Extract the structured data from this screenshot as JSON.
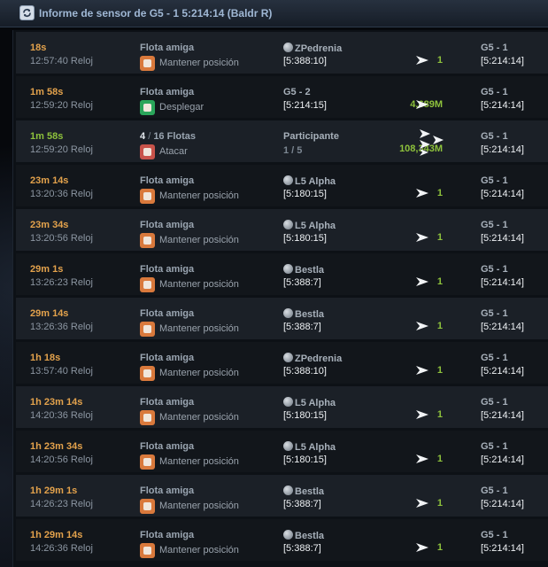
{
  "window": {
    "title": "Informe de sensor de G5 - 1 5:214:14 (Baldr R)",
    "icon": "refresh-icon"
  },
  "rows": [
    {
      "time": "18s",
      "clock": "12:57:40 Reloj",
      "mission_title": "Flota amiga",
      "action": "Mantener posición",
      "icon": "hold-position-icon",
      "origin_name": "ZPedrenia",
      "origin_coord": "[5:388:10]",
      "ships": "1",
      "dest_name": "G5 - 1",
      "dest_coord": "[5:214:14]"
    },
    {
      "time": "1m 58s",
      "clock": "12:59:20 Reloj",
      "mission_title": "Flota amiga",
      "action": "Desplegar",
      "icon": "deploy-icon",
      "origin_name": "G5 - 2",
      "origin_coord": "[5:214:15]",
      "ships": "4,689M",
      "dest_name": "G5 - 1",
      "dest_coord": "[5:214:14]"
    },
    {
      "time": "1m 58s",
      "clock": "12:59:20 Reloj",
      "fleet_count": "4",
      "fleet_total": "16",
      "fleet_word": "Flotas",
      "action": "Atacar",
      "icon": "attack-icon",
      "participant_label": "Participante",
      "participant_count": "1",
      "participant_total": "5",
      "ships": "108,343M",
      "dest_name": "G5 - 1",
      "dest_coord": "[5:214:14]"
    },
    {
      "time": "23m 14s",
      "clock": "13:20:36 Reloj",
      "mission_title": "Flota amiga",
      "action": "Mantener posición",
      "icon": "hold-position-icon",
      "origin_name": "L5 Alpha",
      "origin_coord": "[5:180:15]",
      "ships": "1",
      "dest_name": "G5 - 1",
      "dest_coord": "[5:214:14]"
    },
    {
      "time": "23m 34s",
      "clock": "13:20:56 Reloj",
      "mission_title": "Flota amiga",
      "action": "Mantener posición",
      "icon": "hold-position-icon",
      "origin_name": "L5 Alpha",
      "origin_coord": "[5:180:15]",
      "ships": "1",
      "dest_name": "G5 - 1",
      "dest_coord": "[5:214:14]"
    },
    {
      "time": "29m 1s",
      "clock": "13:26:23 Reloj",
      "mission_title": "Flota amiga",
      "action": "Mantener posición",
      "icon": "hold-position-icon",
      "origin_name": "Bestla",
      "origin_coord": "[5:388:7]",
      "ships": "1",
      "dest_name": "G5 - 1",
      "dest_coord": "[5:214:14]"
    },
    {
      "time": "29m 14s",
      "clock": "13:26:36 Reloj",
      "mission_title": "Flota amiga",
      "action": "Mantener posición",
      "icon": "hold-position-icon",
      "origin_name": "Bestla",
      "origin_coord": "[5:388:7]",
      "ships": "1",
      "dest_name": "G5 - 1",
      "dest_coord": "[5:214:14]"
    },
    {
      "time": "1h 18s",
      "clock": "13:57:40 Reloj",
      "mission_title": "Flota amiga",
      "action": "Mantener posición",
      "icon": "hold-position-icon",
      "origin_name": "ZPedrenia",
      "origin_coord": "[5:388:10]",
      "ships": "1",
      "dest_name": "G5 - 1",
      "dest_coord": "[5:214:14]"
    },
    {
      "time": "1h 23m 14s",
      "clock": "14:20:36 Reloj",
      "mission_title": "Flota amiga",
      "action": "Mantener posición",
      "icon": "hold-position-icon",
      "origin_name": "L5 Alpha",
      "origin_coord": "[5:180:15]",
      "ships": "1",
      "dest_name": "G5 - 1",
      "dest_coord": "[5:214:14]"
    },
    {
      "time": "1h 23m 34s",
      "clock": "14:20:56 Reloj",
      "mission_title": "Flota amiga",
      "action": "Mantener posición",
      "icon": "hold-position-icon",
      "origin_name": "L5 Alpha",
      "origin_coord": "[5:180:15]",
      "ships": "1",
      "dest_name": "G5 - 1",
      "dest_coord": "[5:214:14]"
    },
    {
      "time": "1h 29m 1s",
      "clock": "14:26:23 Reloj",
      "mission_title": "Flota amiga",
      "action": "Mantener posición",
      "icon": "hold-position-icon",
      "origin_name": "Bestla",
      "origin_coord": "[5:388:7]",
      "ships": "1",
      "dest_name": "G5 - 1",
      "dest_coord": "[5:214:14]"
    },
    {
      "time": "1h 29m 14s",
      "clock": "14:26:36 Reloj",
      "mission_title": "Flota amiga",
      "action": "Mantener posición",
      "icon": "hold-position-icon",
      "origin_name": "Bestla",
      "origin_coord": "[5:388:7]",
      "ships": "1",
      "dest_name": "G5 - 1",
      "dest_coord": "[5:214:14]"
    }
  ],
  "colors": {
    "time_orange": "#e3a24c",
    "time_green": "#8ec23c",
    "ships_green": "#8ec23c",
    "hold_icon": "#d9793c",
    "deploy_icon": "#2aa55a",
    "attack_icon": "#c8534a"
  }
}
